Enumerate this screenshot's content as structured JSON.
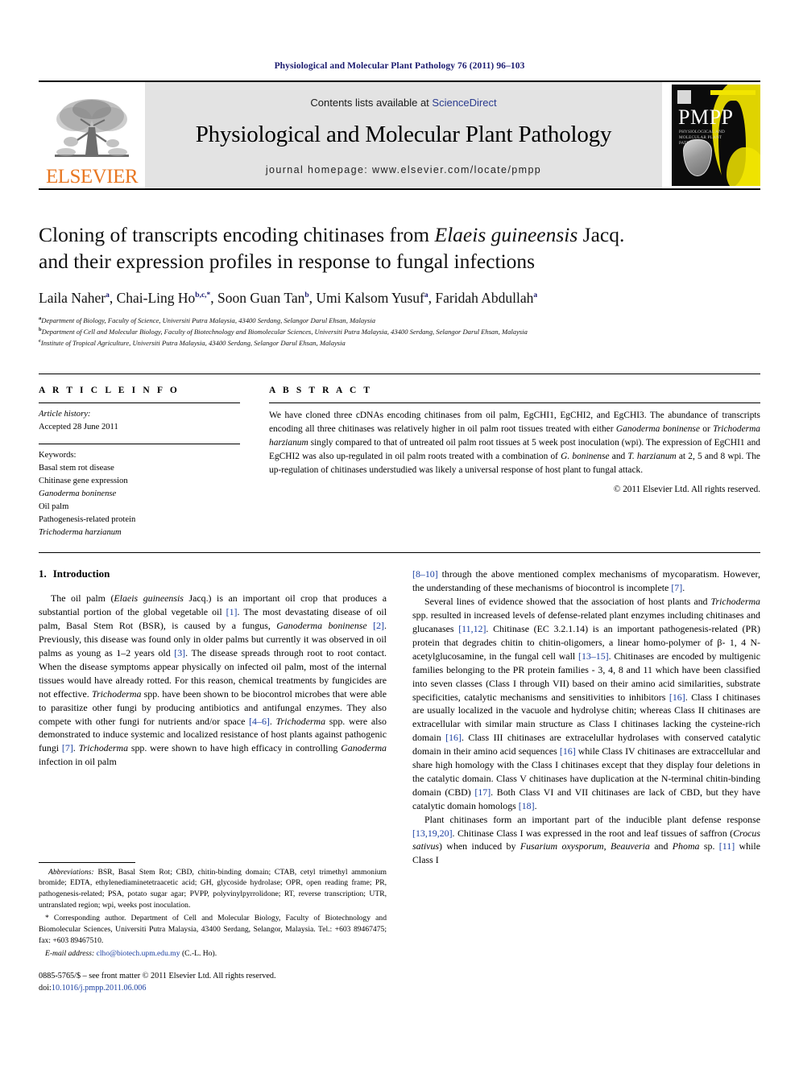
{
  "running_head": "Physiological and Molecular Plant Pathology 76 (2011) 96–103",
  "masthead": {
    "publisher_wordmark": "ELSEVIER",
    "contents_prefix": "Contents lists available at ",
    "contents_link": "ScienceDirect",
    "journal_title": "Physiological and Molecular Plant Pathology",
    "homepage": "journal homepage: www.elsevier.com/locate/pmpp",
    "cover": {
      "acronym": "PMPP",
      "subtitle": "PHYSIOLOGICAL AND MOLECULAR PLANT PATHOLOGY"
    }
  },
  "article": {
    "title_line1_a": "Cloning of transcripts encoding chitinases from ",
    "title_line1_italic": "Elaeis guineensis",
    "title_line1_b": " Jacq.",
    "title_line2": "and their expression profiles in response to fungal infections",
    "authors": [
      {
        "name": "Laila Naher",
        "sup": "a",
        "sep": ", "
      },
      {
        "name": "Chai-Ling Ho",
        "sup": "b,c,*",
        "sep": ", "
      },
      {
        "name": "Soon Guan Tan",
        "sup": "b",
        "sep": ", "
      },
      {
        "name": "Umi Kalsom Yusuf",
        "sup": "a",
        "sep": ", "
      },
      {
        "name": "Faridah Abdullah",
        "sup": "a",
        "sep": ""
      }
    ],
    "affiliations": [
      {
        "marker": "a",
        "text": "Department of Biology, Faculty of Science, Universiti Putra Malaysia, 43400 Serdang, Selangor Darul Ehsan, Malaysia"
      },
      {
        "marker": "b",
        "text": "Department of Cell and Molecular Biology, Faculty of Biotechnology and Biomolecular Sciences, Universiti Putra Malaysia, 43400 Serdang, Selangor Darul Ehsan, Malaysia"
      },
      {
        "marker": "c",
        "text": "Institute of Tropical Agriculture, Universiti Putra Malaysia, 43400 Serdang, Selangor Darul Ehsan, Malaysia"
      }
    ]
  },
  "article_info": {
    "heading": "A R T I C L E   I N F O",
    "history_label": "Article history:",
    "history_value": "Accepted 28 June 2011",
    "keywords_label": "Keywords:",
    "keywords": [
      {
        "text": "Basal stem rot disease",
        "italic": false
      },
      {
        "text": "Chitinase gene expression",
        "italic": false
      },
      {
        "text": "Ganoderma boninense",
        "italic": true
      },
      {
        "text": "Oil palm",
        "italic": false
      },
      {
        "text": "Pathogenesis-related protein",
        "italic": false
      },
      {
        "text": "Trichoderma harzianum",
        "italic": true
      }
    ]
  },
  "abstract": {
    "heading": "A B S T R A C T",
    "copyright": "© 2011 Elsevier Ltd. All rights reserved."
  },
  "sections": {
    "intro_number": "1.",
    "intro_title": "Introduction"
  },
  "footnotes": {
    "abbrev_label": "Abbreviations:",
    "corresponding_star": "*",
    "email_label": "E-mail address:",
    "email": "clho@biotech.upm.edu.my",
    "email_suffix": " (C.-L. Ho).",
    "issn_line": "0885-5765/$ – see front matter © 2011 Elsevier Ltd. All rights reserved.",
    "doi_label": "doi:",
    "doi_value": "10.1016/j.pmpp.2011.06.006"
  }
}
